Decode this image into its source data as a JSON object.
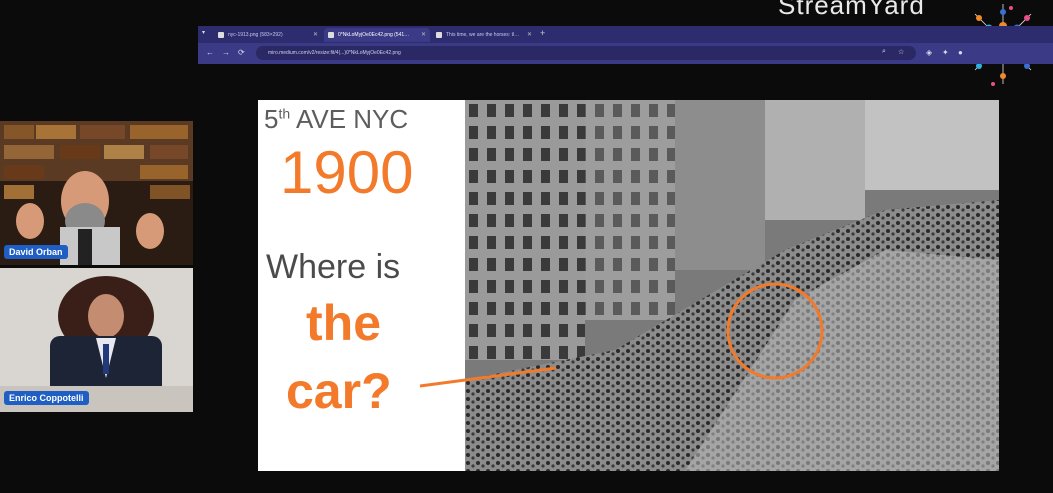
{
  "brand": {
    "name": "StreamYard"
  },
  "browser": {
    "tabs": [
      {
        "title": "nyc-1913.png (583×292)"
      },
      {
        "title": "0*NkLoMyjOe0Ec42.png (541…"
      },
      {
        "title": "This time, we are the horses: tl…"
      }
    ],
    "new_tab": "+",
    "back": "←",
    "forward": "→",
    "reload": "⟳",
    "url": "miro.medium.com/v2/resize:fit/4(...)0*NkLoMyjOe0Ec42.png"
  },
  "slide": {
    "ave_text": "5",
    "ave_sup": "th",
    "ave_rest": " AVE NYC",
    "year": "1900",
    "where": "Where is",
    "the": "the",
    "car": "car?"
  },
  "participants": [
    {
      "name": "David Orban"
    },
    {
      "name": "Enrico Coppotelli"
    }
  ],
  "colors": {
    "accent": "#f27a2a",
    "name_badge": "#1f5fc4",
    "browser": "#3b3a86"
  }
}
